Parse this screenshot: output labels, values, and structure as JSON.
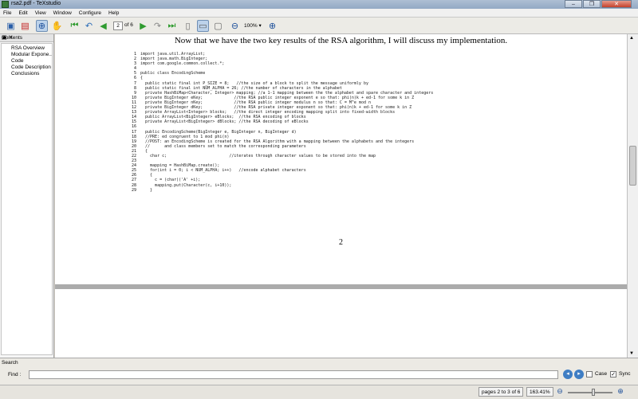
{
  "window": {
    "title": "rsa2.pdf - TeXstudio",
    "btn_min": "–",
    "btn_max": "❐",
    "btn_close": "✕"
  },
  "menu": [
    "File",
    "Edit",
    "View",
    "Window",
    "Configure",
    "Help"
  ],
  "toolbar": {
    "page_value": "2",
    "page_of": "of 6",
    "zoom": "100%"
  },
  "sidebar": {
    "title": "Contents",
    "controls": "▣ ✕",
    "items": [
      "RSA Overview",
      "Modular Expone...",
      "Code",
      "Code Description",
      "Conclusions"
    ]
  },
  "document": {
    "heading": "Now that we have the two key results of the RSA algorithm, I will discuss my implementation.",
    "page_number": "2",
    "code_lines": [
      {
        "n": "1",
        "t": "import java.util.ArrayList;"
      },
      {
        "n": "2",
        "t": "import java.math.BigInteger;"
      },
      {
        "n": "3",
        "t": "import com.google.common.collect.*;"
      },
      {
        "n": "4",
        "t": ""
      },
      {
        "n": "5",
        "t": "public class EncodingScheme"
      },
      {
        "n": "6",
        "t": "{"
      },
      {
        "n": "7",
        "t": "  public static final int P_SIZE = 8;   //the size of a block to split the message uniformly by"
      },
      {
        "n": "8",
        "t": "  public static final int NUM_ALPHA = 26; //the number of characters in the alphabet"
      },
      {
        "n": "9",
        "t": "  private HashBiMap<Character, Integer> mapping; //a 1-1 mapping between the the alphabet and spare character and integers"
      },
      {
        "n": "10",
        "t": "  private BigInteger eKey;             //the RSA public integer exponent e so that: phi(n)k + ed-1 for some k in Z"
      },
      {
        "n": "11",
        "t": "  private BigInteger nKey;             //the RSA public integer modulus n so that: C = M^e mod n"
      },
      {
        "n": "12",
        "t": "  private BigInteger dKey;             //the RSA private integer exponent so that: phi(n)k + ed-1 for some k in Z"
      },
      {
        "n": "13",
        "t": "  private ArrayList<Integer> blocks;   //the direct integer encoding mapping split into fixed-width blocks"
      },
      {
        "n": "14",
        "t": "  public ArrayList<BigInteger> eBlocks;  //the RSA encoding of blocks"
      },
      {
        "n": "15",
        "t": "  private ArrayList<BigInteger> dBlocks; //the RSA decoding of eBlocks"
      },
      {
        "n": "16",
        "t": ""
      },
      {
        "n": "17",
        "t": "  public EncodingScheme(BigInteger e, BigInteger n, BigInteger d)"
      },
      {
        "n": "18",
        "t": "  //PRE: ed congruent to 1 mod phi(n)"
      },
      {
        "n": "19",
        "t": "  //POST: an EncodingScheme is created for the RSA Algorithm with a mapping between the alphabets and the integers"
      },
      {
        "n": "20",
        "t": "  //      and class members set to match the corresponding parameters"
      },
      {
        "n": "21",
        "t": "  {"
      },
      {
        "n": "22",
        "t": "    char c;                          //iterates through character values to be stored into the map"
      },
      {
        "n": "23",
        "t": ""
      },
      {
        "n": "24",
        "t": "    mapping = HashBiMap.create();"
      },
      {
        "n": "25",
        "t": "    for(int i = 0; i < NUM_ALPHA; i++)   //encode alphabet characters"
      },
      {
        "n": "26",
        "t": "    {"
      },
      {
        "n": "27",
        "t": "      c = (char)('A' +i);"
      },
      {
        "n": "28",
        "t": "      mapping.put(Character(c, i+10));"
      },
      {
        "n": "29",
        "t": "    }"
      }
    ]
  },
  "search": {
    "title": "Search",
    "find_label": "Find :",
    "find_value": "",
    "case_label": "Case",
    "sync_label": "Sync",
    "sync_checked": "✓"
  },
  "status": {
    "pages": "pages 2 to 3 of 6",
    "zoom": "163.41%"
  }
}
